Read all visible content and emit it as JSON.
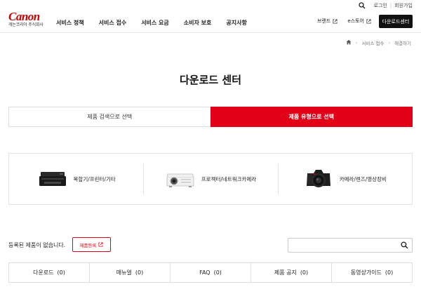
{
  "header": {
    "logo": "Canon",
    "logo_sub": "캐논코리아 주식회사",
    "nav": [
      "서비스 정책",
      "서비스 접수",
      "서비스 요금",
      "소비자 보호",
      "공지사항"
    ],
    "login": "로그인",
    "signup": "회원가입",
    "brand_link": "브랜드",
    "estore_link": "e스토어",
    "download_center_btn": "다운로드센터"
  },
  "breadcrumb": {
    "level1": "서비스 접수",
    "level2": "해결하기"
  },
  "page": {
    "title": "다운로드 센터"
  },
  "tabs": {
    "search": "제품 검색으로 선택",
    "type": "제품 유형으로 선택"
  },
  "categories": [
    {
      "label": "복합기/프린터/기타",
      "icon": "printer-icon"
    },
    {
      "label": "프로젝터/네트워크카메라",
      "icon": "projector-icon"
    },
    {
      "label": "카메라/렌즈/영상장비",
      "icon": "camera-icon"
    }
  ],
  "registered": {
    "message": "등록된 제품이 없습니다.",
    "register_btn": "제품등록",
    "search_placeholder": ""
  },
  "result_tabs": [
    {
      "label": "다운로드",
      "count": "(0)"
    },
    {
      "label": "매뉴얼",
      "count": "(0)"
    },
    {
      "label": "FAQ",
      "count": "(0)"
    },
    {
      "label": "제품 공지",
      "count": "(0)"
    },
    {
      "label": "동영상가이드",
      "count": "(0)"
    }
  ],
  "colors": {
    "brand": "#cc0000",
    "accent": "#e10018",
    "dark": "#111111"
  }
}
